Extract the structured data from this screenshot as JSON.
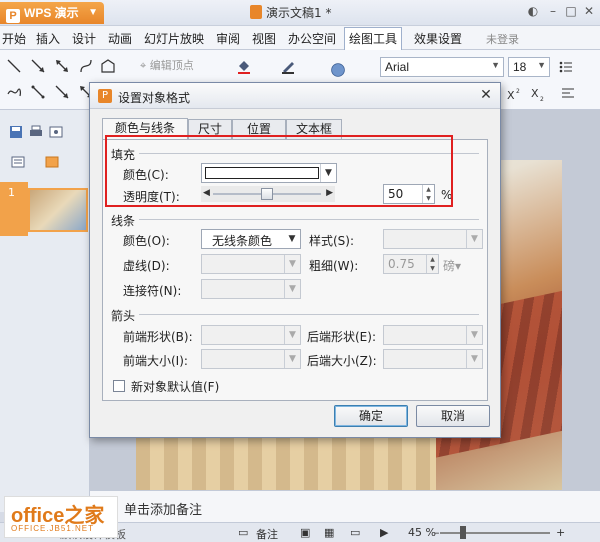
{
  "app": {
    "name": "WPS 演示",
    "doc_title": "演示文稿1 *"
  },
  "menu": {
    "items": [
      "开始",
      "插入",
      "设计",
      "动画",
      "幻灯片放映",
      "审阅",
      "视图",
      "办公空间",
      "绘图工具",
      "效果设置"
    ],
    "active": "绘图工具",
    "login": "未登录"
  },
  "ribbon": {
    "edit_points": "编辑顶点",
    "font": "Arial",
    "font_size": "18"
  },
  "slides": {
    "current": "1"
  },
  "notes": {
    "placeholder": "单击添加备注"
  },
  "status": {
    "notes_label": "备注",
    "zoom": "45 %",
    "template_text": "默认设计模板"
  },
  "watermark": {
    "line1": "office之家",
    "line2": "OFFICE.JB51.NET"
  },
  "dialog": {
    "title": "设置对象格式",
    "tabs": [
      "颜色与线条",
      "尺寸",
      "位置",
      "文本框"
    ],
    "active_tab": "颜色与线条",
    "fill": {
      "section": "填充",
      "color_label": "颜色(C):",
      "color_value": "#ffffff",
      "transparency_label": "透明度(T):",
      "transparency_value": "50",
      "transparency_unit": "%",
      "transparency_fraction": 0.5
    },
    "line": {
      "section": "线条",
      "color_label": "颜色(O):",
      "color_value": "无线条颜色",
      "style_label": "样式(S):",
      "dash_label": "虚线(D):",
      "weight_label": "粗细(W):",
      "weight_value": "0.75",
      "weight_unit": "磅",
      "connector_label": "连接符(N):"
    },
    "arrows": {
      "section": "箭头",
      "begin_style_label": "前端形状(B):",
      "end_style_label": "后端形状(E):",
      "begin_size_label": "前端大小(I):",
      "end_size_label": "后端大小(Z):"
    },
    "default_checkbox": "新对象默认值(F)",
    "ok": "确定",
    "cancel": "取消"
  },
  "colors": {
    "highlight": "#e02020",
    "wps_orange": "#e8862a"
  }
}
